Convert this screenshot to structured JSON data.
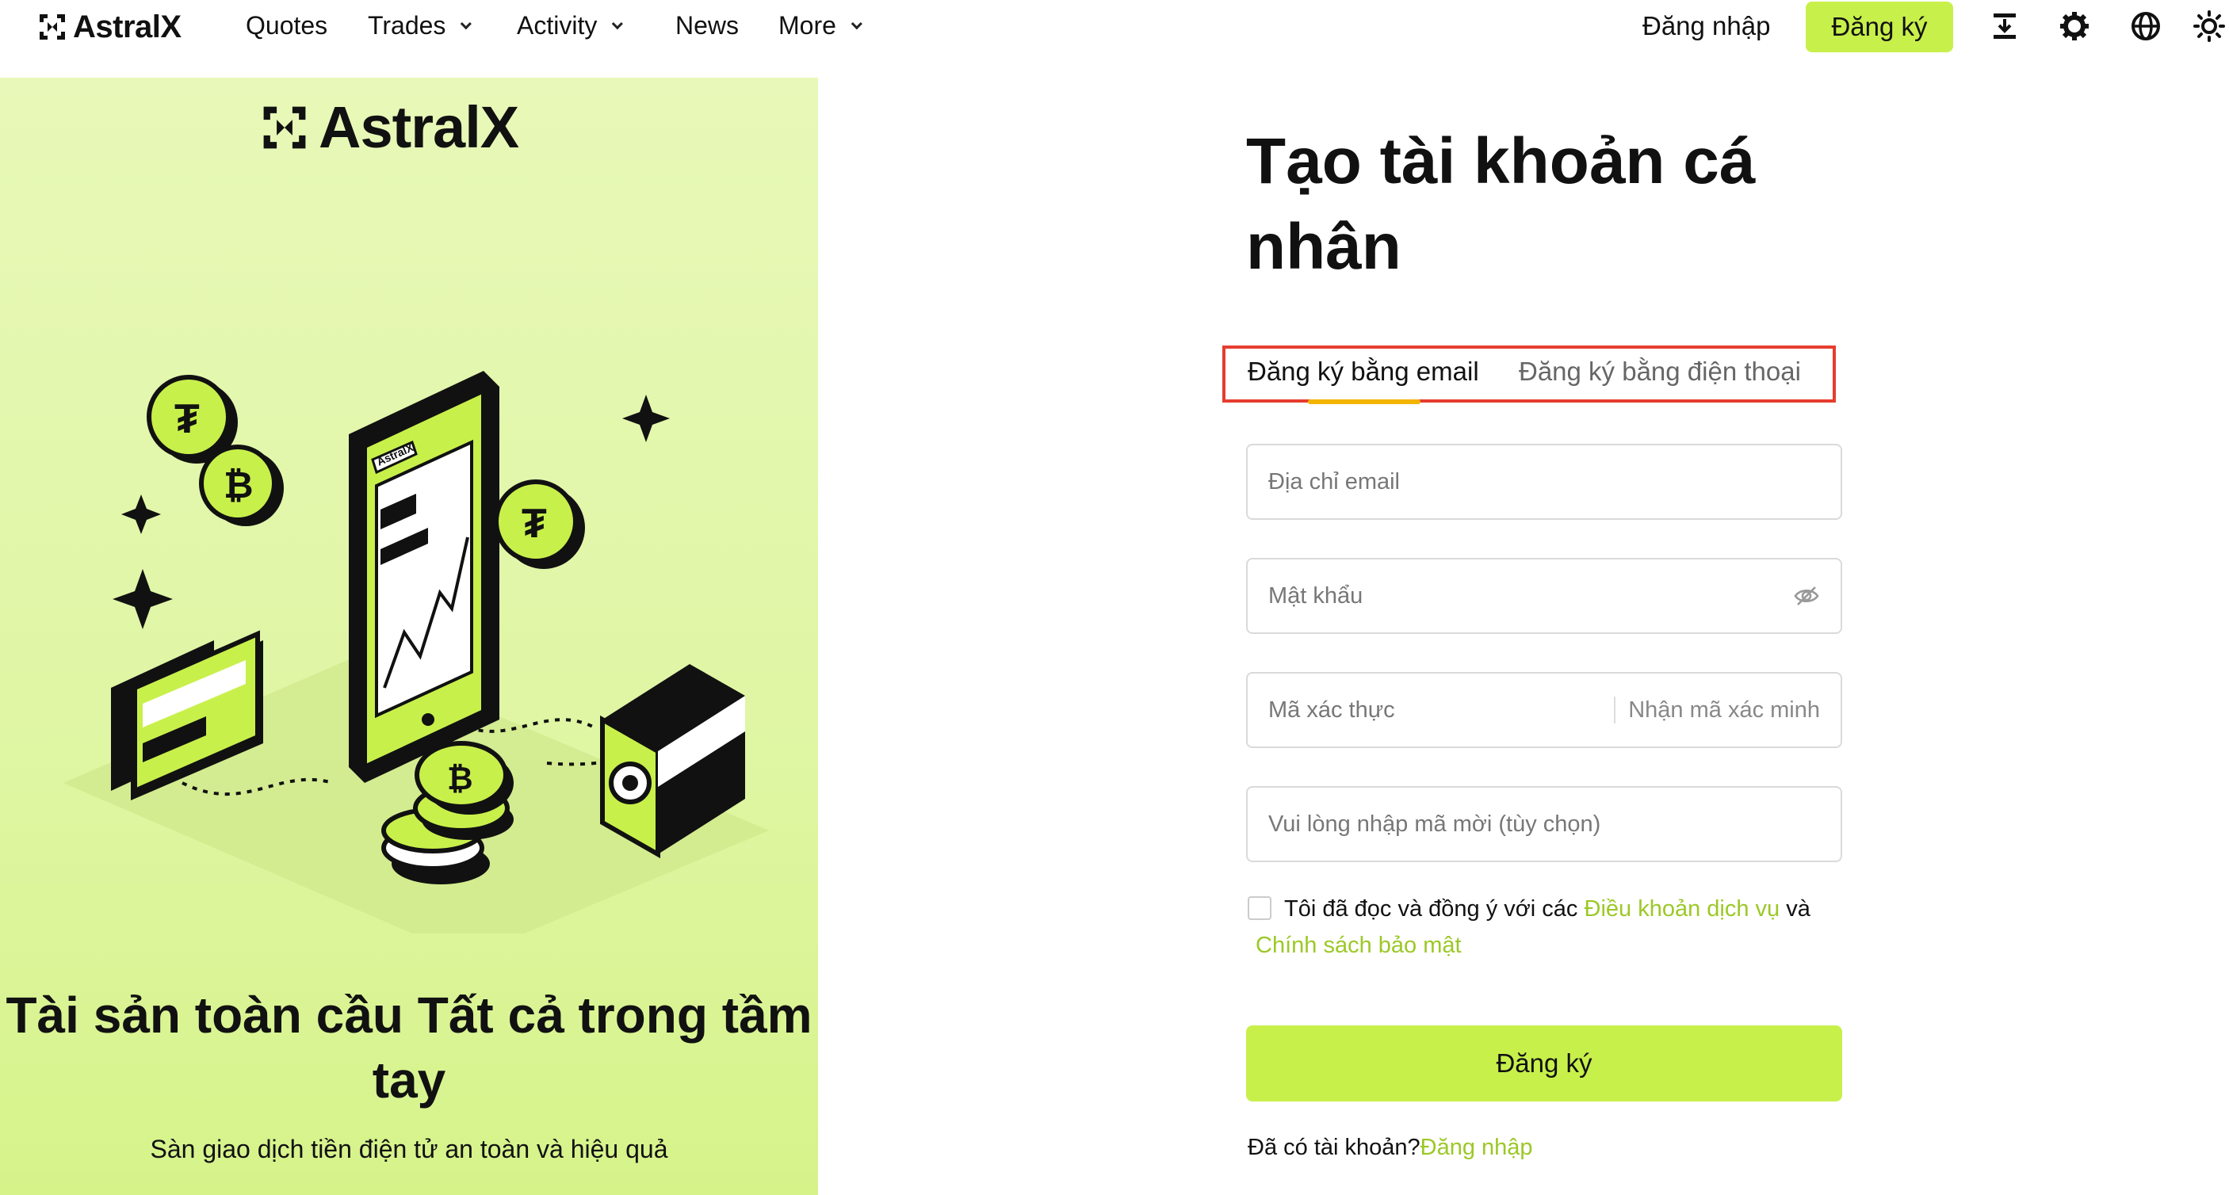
{
  "nav": {
    "brand": "AstralX",
    "links": [
      {
        "label": "Quotes"
      },
      {
        "label": "Trades"
      },
      {
        "label": "Activity"
      },
      {
        "label": "News"
      },
      {
        "label": "More"
      }
    ],
    "login_label": "Đăng nhập",
    "signup_label": "Đăng ký",
    "icons": [
      "download-icon",
      "gear-icon",
      "globe-icon",
      "sun-icon"
    ]
  },
  "panel": {
    "brand": "AstralX",
    "hero_title": "Tài sản toàn cầu Tất cả trong tầm tay",
    "hero_subtitle": "Sàn giao dịch tiền điện tử an toàn và hiệu quả",
    "phone_brand": "AstralX"
  },
  "form": {
    "title": "Tạo tài khoản cá nhân",
    "tabs": [
      {
        "label": "Đăng ký bằng email",
        "active": true
      },
      {
        "label": "Đăng ký bằng điện thoại",
        "active": false
      }
    ],
    "email_placeholder": "Địa chỉ email",
    "password_placeholder": "Mật khẩu",
    "code_placeholder": "Mã xác thực",
    "get_code_label": "Nhận mã xác minh",
    "invite_placeholder": "Vui lòng nhập mã mời (tùy chọn)",
    "agree_prefix": "Tôi đã đọc và đồng ý với các ",
    "terms_link": "Điều khoản dịch vụ",
    "agree_and": " và",
    "privacy_link": "Chính sách bảo mật",
    "submit_label": "Đăng ký",
    "have_account_text": "Đã có tài khoản?",
    "login_link": "Đăng nhập"
  },
  "colors": {
    "accent": "#c8f04b",
    "link": "#9cc827",
    "panel_bg": "#e3f7ad",
    "highlight_box": "#e53d2f",
    "tab_underline": "#f2b400"
  }
}
